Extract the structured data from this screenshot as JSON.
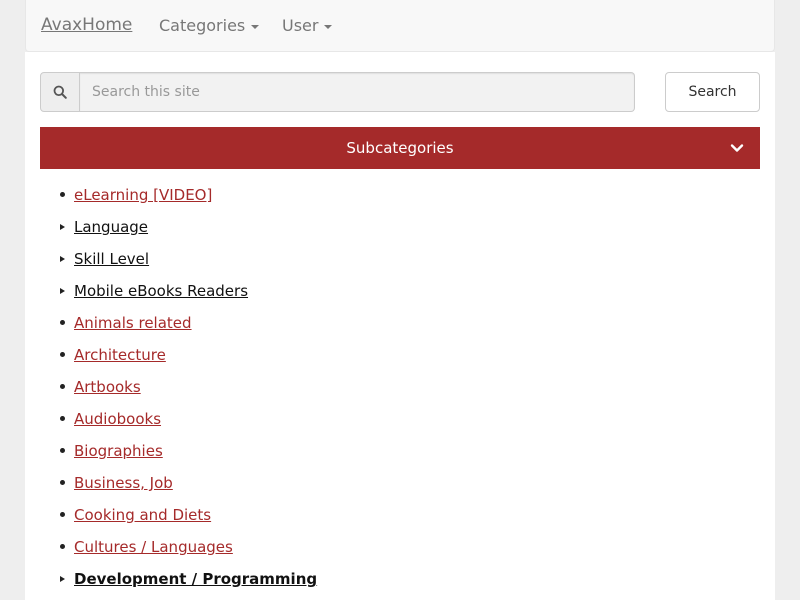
{
  "navbar": {
    "brand": "AvaxHome",
    "categories_label": "Categories",
    "user_label": "User"
  },
  "search": {
    "placeholder": "Search this site",
    "button_label": "Search",
    "icon": "search-icon"
  },
  "subcategories": {
    "title": "Subcategories",
    "icon": "chevron-down-icon",
    "bar_color": "#a52a2a",
    "items": [
      {
        "label": "eLearning [VIDEO]",
        "style": "red",
        "bullet": "dot"
      },
      {
        "label": "Language",
        "style": "dark",
        "bullet": "triangle"
      },
      {
        "label": "Skill Level",
        "style": "dark",
        "bullet": "triangle"
      },
      {
        "label": "Mobile eBooks Readers",
        "style": "dark",
        "bullet": "triangle"
      },
      {
        "label": "Animals related",
        "style": "red",
        "bullet": "dot"
      },
      {
        "label": "Architecture",
        "style": "red",
        "bullet": "dot"
      },
      {
        "label": "Artbooks",
        "style": "red",
        "bullet": "dot"
      },
      {
        "label": "Audiobooks",
        "style": "red",
        "bullet": "dot"
      },
      {
        "label": "Biographies",
        "style": "red",
        "bullet": "dot"
      },
      {
        "label": "Business, Job",
        "style": "red",
        "bullet": "dot"
      },
      {
        "label": "Cooking and Diets",
        "style": "red",
        "bullet": "dot"
      },
      {
        "label": "Cultures / Languages",
        "style": "red",
        "bullet": "dot"
      },
      {
        "label": "Development / Programming",
        "style": "dark-bold",
        "bullet": "triangle"
      }
    ]
  }
}
